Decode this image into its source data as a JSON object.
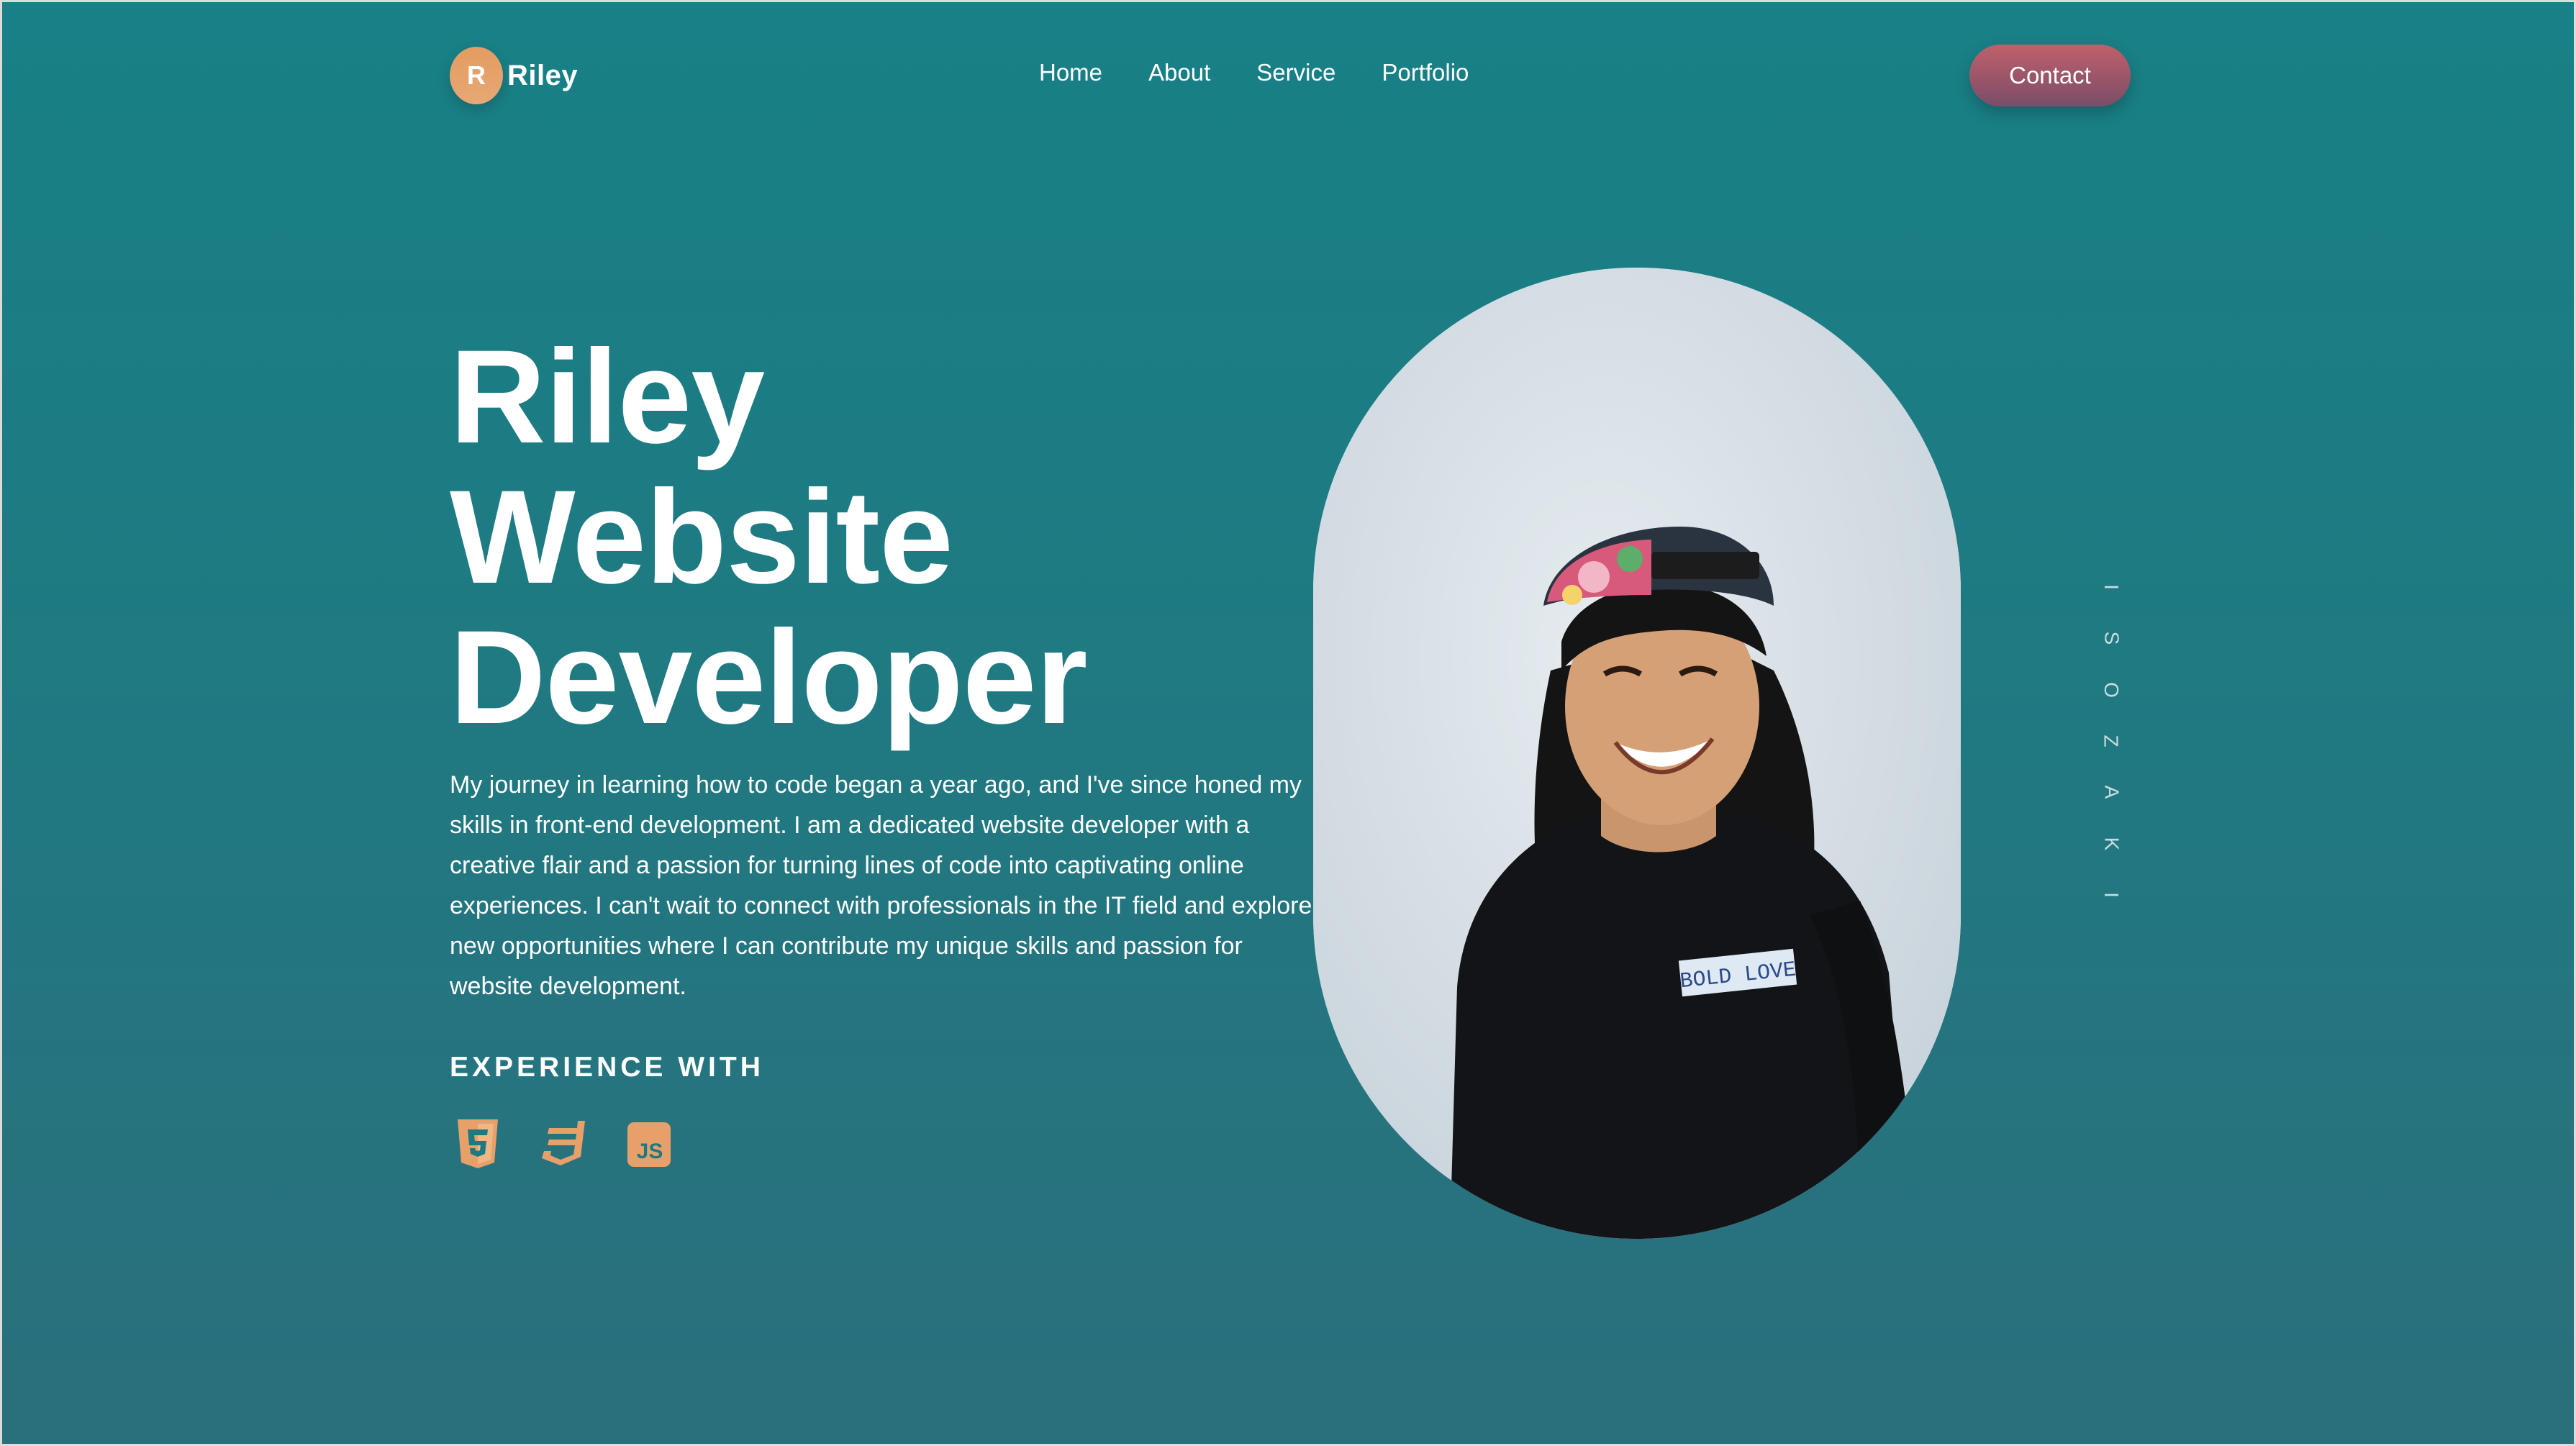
{
  "brand": {
    "badge": "R",
    "name": "Riley"
  },
  "nav": {
    "items": [
      "Home",
      "About",
      "Service",
      "Portfolio"
    ]
  },
  "contact_label": "Contact",
  "hero": {
    "title_lines": [
      "Riley",
      "Website",
      "Developer"
    ],
    "description": "My journey in learning how to code began a year ago, and I've since honed my skills in front-end development. I am a dedicated website developer with a creative flair and a passion for turning lines of code into captivating online experiences. I can't wait to connect with professionals in the IT field and explore new opportunities where I can contribute my unique skills and passion for website development."
  },
  "experience": {
    "title": "EXPERIENCE WITH",
    "icons": [
      "html5-icon",
      "css3-icon",
      "javascript-icon"
    ],
    "js_label": "JS",
    "icon_color": "#e7a06a"
  },
  "portrait": {
    "shirt_text": "BOLD LOVE"
  },
  "vertical_name": [
    "I",
    "S",
    "O",
    "Z",
    "A",
    "K",
    "I"
  ],
  "colors": {
    "bg_top": "#188086",
    "bg_bottom": "#2a6f7c",
    "accent_orange": "#e49c60",
    "contact_top": "#c0606b",
    "contact_bottom": "#7a4d6a"
  }
}
